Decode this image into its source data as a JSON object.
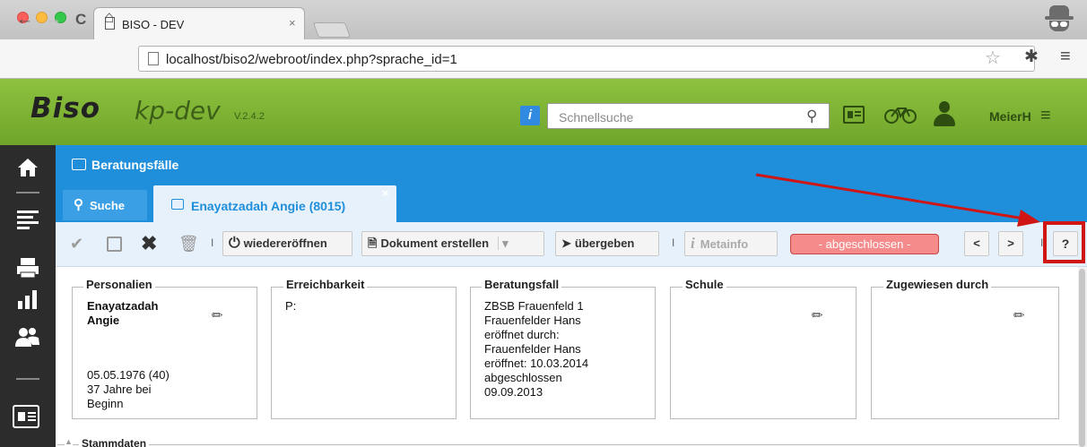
{
  "browser": {
    "tab_title": "BISO - DEV",
    "tab_close": "×",
    "url": "localhost/biso2/webroot/index.php?sprache_id=1",
    "back": "←",
    "forward": "→",
    "reload": "C",
    "home": "⌂",
    "star": "☆",
    "ext": "✱",
    "menu": "≡"
  },
  "app": {
    "logo": "Biso",
    "env": "kp-dev",
    "version": "V.2.4.2",
    "info_icon": "i",
    "search_placeholder": "Schnellsuche",
    "user": "MeierH",
    "menu_icon": "≡",
    "accent_green": "#7db234",
    "accent_blue": "#1f8fdb"
  },
  "sidebar": {
    "icons": [
      "home-icon",
      "list-icon",
      "print-icon",
      "chart-icon",
      "users-icon",
      "card-icon"
    ]
  },
  "section": {
    "title": "Beratungsfälle",
    "tabs": [
      {
        "label": "Suche"
      },
      {
        "label": "Enayatzadah Angie (8015)",
        "close": "×"
      }
    ]
  },
  "actions": {
    "reopen": "wiedereröffnen",
    "create_doc": "Dokument erstellen",
    "handover": "übergeben",
    "metainfo": "Metainfo",
    "status": "- abgeschlossen -",
    "prev": "<",
    "next": ">",
    "help": "?",
    "sep": "I"
  },
  "cards": {
    "personalien": {
      "title": "Personalien",
      "name_line1": "Enayatzadah",
      "name_line2": "Angie",
      "dob": "05.05.1976 (40)",
      "age_line1": "37 Jahre bei",
      "age_line2": "Beginn"
    },
    "erreichbarkeit": {
      "title": "Erreichbarkeit",
      "phone": "P:"
    },
    "beratungsfall": {
      "title": "Beratungsfall",
      "lines": [
        "ZBSB Frauenfeld 1",
        "Frauenfelder Hans",
        "eröffnet durch:",
        "Frauenfelder Hans",
        "eröffnet: 10.03.2014",
        "abgeschlossen",
        "09.09.2013"
      ]
    },
    "schule": {
      "title": "Schule"
    },
    "zugewiesen": {
      "title": "Zugewiesen durch"
    }
  },
  "stammdaten": "Stammdaten"
}
